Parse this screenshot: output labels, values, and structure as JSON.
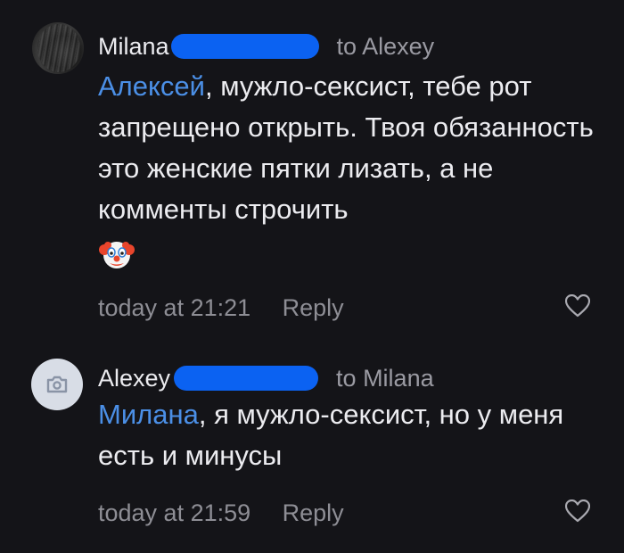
{
  "comments": [
    {
      "author": "Milana",
      "to": "to Alexey",
      "mention": "Алексей",
      "text": ", мужло-сексист, тебе рот запрещено открыть. Твоя обязанность это женские пятки лизать, а не комменты строчить",
      "emoji": "clown-face",
      "time": "today at 21:21",
      "reply_label": "Reply"
    },
    {
      "author": "Alexey",
      "to": "to Milana",
      "mention": "Милана",
      "text": ", я мужло-сексист, но у меня есть и минусы",
      "time": "today at 21:59",
      "reply_label": "Reply"
    }
  ],
  "colors": {
    "background": "#141418",
    "mention": "#4b8fe6",
    "redaction": "#0b62f2",
    "muted": "#8e8e95"
  }
}
